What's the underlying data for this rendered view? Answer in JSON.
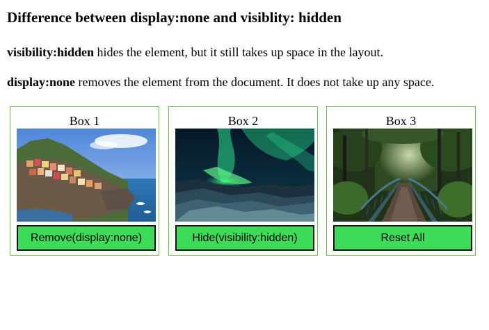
{
  "page": {
    "title": "Difference between display:none and visiblity: hidden"
  },
  "paragraphs": [
    {
      "term": "visibility:hidden",
      "text": " hides the element, but it still takes up space in the layout."
    },
    {
      "term": "display:none",
      "text": " removes the element from the document. It does not take up any space."
    }
  ],
  "boxes": [
    {
      "label": "Box 1",
      "image": "coastal-village-photo",
      "button": "Remove(display:none)"
    },
    {
      "label": "Box 2",
      "image": "aurora-borealis-photo",
      "button": "Hide(visibility:hidden)"
    },
    {
      "label": "Box 3",
      "image": "forest-bridge-photo",
      "button": "Reset All"
    }
  ],
  "colors": {
    "box_border": "#6cc04a",
    "button_fill": "#3ddb57",
    "button_border": "#111111"
  }
}
